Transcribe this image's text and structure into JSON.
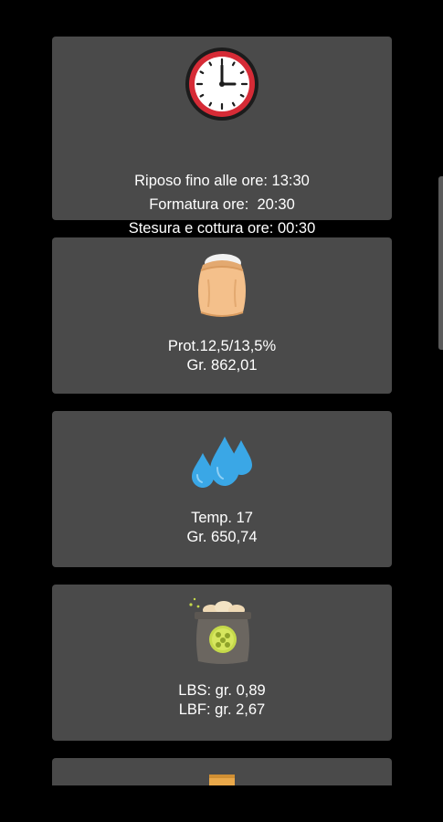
{
  "cards": [
    {
      "icon": "clock-icon",
      "lines": [
        "Riposo fino alle ore: 13:30",
        "Formatura ore:  20:30",
        "Stesura e cottura ore: 00:30"
      ]
    },
    {
      "icon": "flour-sack-icon",
      "lines": [
        "Prot.12,5/13,5%",
        "Gr. 862,01"
      ]
    },
    {
      "icon": "water-drops-icon",
      "lines": [
        "Temp. 17",
        "Gr. 650,74"
      ]
    },
    {
      "icon": "yeast-sack-icon",
      "lines": [
        "LBS: gr. 0,89",
        "LBF: gr. 2,67"
      ]
    },
    {
      "icon": "jar-icon",
      "lines": []
    }
  ],
  "colors": {
    "card_background": "#4a4a4a",
    "screen_background": "#000000",
    "text": "#ffffff",
    "clock_red": "#d62b36",
    "flour_sack": "#f4c08b",
    "water_blue": "#3aa7e6",
    "yeast_sack": "#6b6660",
    "yeast_label": "#c5d94a"
  }
}
